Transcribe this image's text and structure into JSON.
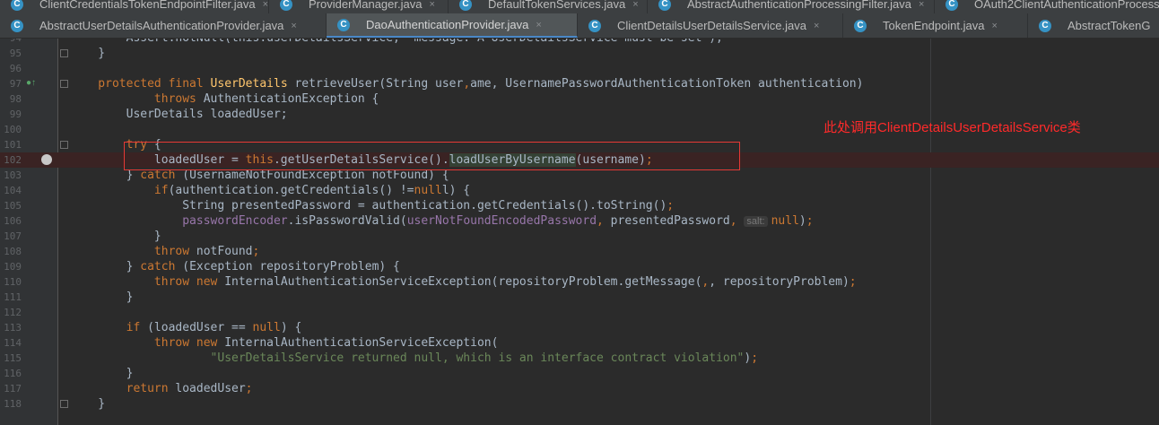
{
  "tabs_row1": [
    "ClientCredentialsTokenEndpointFilter.java",
    "ProviderManager.java",
    "DefaultTokenServices.java",
    "AbstractAuthenticationProcessingFilter.java",
    "OAuth2ClientAuthenticationProcess"
  ],
  "tabs_row2": [
    "AbstractUserDetailsAuthenticationProvider.java",
    "DaoAuthenticationProvider.java",
    "ClientDetailsUserDetailsService.java",
    "TokenEndpoint.java",
    "AbstractTokenG"
  ],
  "active_tab": "DaoAuthenticationProvider.java",
  "close_glyph": "×",
  "tab_icon_letter": "C",
  "param_hint": "salt:",
  "annotation": "此处调用ClientDetailsUserDetailsService类",
  "colors": {
    "keyword": "#cc7832",
    "method": "#ffc66d",
    "field": "#9876aa",
    "string": "#6a8759",
    "annotation": "#ff2a2a",
    "highlight_box": "#e53935"
  },
  "icons": [
    "class-file-icon",
    "breakpoint-icon",
    "override-method-icon",
    "fold-marker-icon"
  ],
  "lines": [
    {
      "n": "94",
      "code": "        Assert.notNull(this.userDetailsService, \"message: A UserDetailsService must be set\");"
    },
    {
      "n": "95",
      "code": "    }"
    },
    {
      "n": "96",
      "code": ""
    },
    {
      "n": "97",
      "code": "    protected final UserDetails retrieveUser(String username, UsernamePasswordAuthenticationToken authentication)"
    },
    {
      "n": "98",
      "code": "            throws AuthenticationException {"
    },
    {
      "n": "99",
      "code": "        UserDetails loadedUser;"
    },
    {
      "n": "100",
      "code": ""
    },
    {
      "n": "101",
      "code": "        try {"
    },
    {
      "n": "102",
      "code": "            loadedUser = this.getUserDetailsService().loadUserByUsername(username);"
    },
    {
      "n": "103",
      "code": "        } catch (UsernameNotFoundException notFound) {"
    },
    {
      "n": "104",
      "code": "            if(authentication.getCredentials() != null) {"
    },
    {
      "n": "105",
      "code": "                String presentedPassword = authentication.getCredentials().toString();"
    },
    {
      "n": "106",
      "code": "                passwordEncoder.isPasswordValid(userNotFoundEncodedPassword, presentedPassword, salt: null);"
    },
    {
      "n": "107",
      "code": "            }"
    },
    {
      "n": "108",
      "code": "            throw notFound;"
    },
    {
      "n": "109",
      "code": "        } catch (Exception repositoryProblem) {"
    },
    {
      "n": "110",
      "code": "            throw new InternalAuthenticationServiceException(repositoryProblem.getMessage(), repositoryProblem);"
    },
    {
      "n": "111",
      "code": "        }"
    },
    {
      "n": "112",
      "code": ""
    },
    {
      "n": "113",
      "code": "        if (loadedUser == null) {"
    },
    {
      "n": "114",
      "code": "            throw new InternalAuthenticationServiceException("
    },
    {
      "n": "115",
      "code": "                    \"UserDetailsService returned null, which is an interface contract violation\");"
    },
    {
      "n": "116",
      "code": "        }"
    },
    {
      "n": "117",
      "code": "        return loadedUser;"
    },
    {
      "n": "118",
      "code": "    }"
    }
  ]
}
